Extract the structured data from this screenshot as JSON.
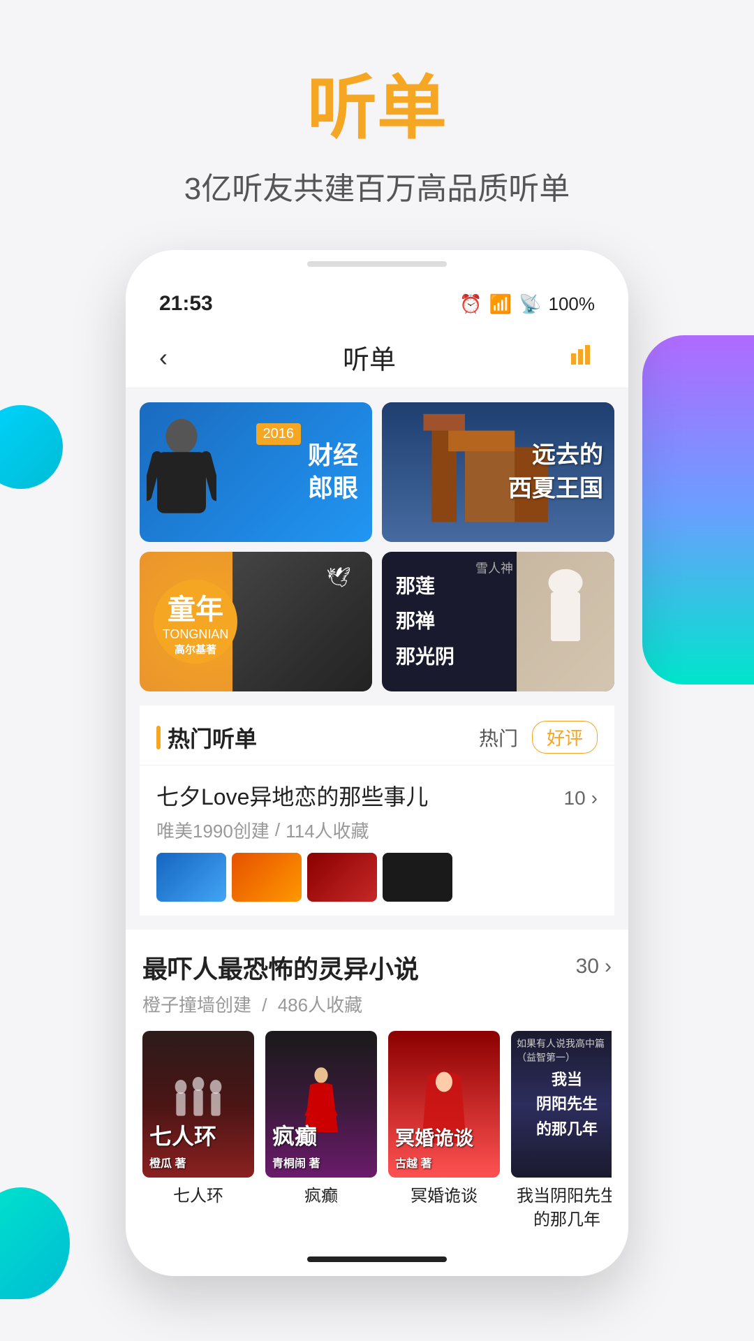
{
  "page": {
    "title": "听单",
    "subtitle": "3亿听友共建百万高品质听单",
    "bg_color": "#f5f5f7",
    "accent_color": "#f5a623"
  },
  "status_bar": {
    "time": "21:53",
    "battery": "100%"
  },
  "nav": {
    "back_icon": "‹",
    "title": "听单",
    "chart_icon": "|||"
  },
  "banners": [
    {
      "id": "b1",
      "year": "2016",
      "title": "财经郎眼",
      "style": "blue"
    },
    {
      "id": "b2",
      "title": "远去的\n西夏王国",
      "style": "desert"
    },
    {
      "id": "b3",
      "main": "童年",
      "sub": "TONGNIAN",
      "author": "高尔基著",
      "style": "childhood"
    },
    {
      "id": "b4",
      "lines": [
        "那莲",
        "那禅",
        "那光阴"
      ],
      "style": "woman"
    }
  ],
  "hot_section": {
    "title": "热门听单",
    "tab_hot": "热门",
    "tab_good": "好评"
  },
  "playlist1": {
    "title": "七夕Love异地恋的那些事儿",
    "creator": "唯美1990创建",
    "saves": "114人收藏",
    "count": "10"
  },
  "playlist2": {
    "title": "最吓人最恐怖的灵异小说",
    "creator": "橙子撞墙创建",
    "saves": "486人收藏",
    "count": "30"
  },
  "books": [
    {
      "id": "bk1",
      "title": "七人环",
      "label": "七人环",
      "style": "book-1"
    },
    {
      "id": "bk2",
      "title": "疯癫",
      "label": "疯癫",
      "style": "book-2"
    },
    {
      "id": "bk3",
      "title": "冥婚诡谈",
      "label": "冥婚诡谈",
      "style": "book-3"
    },
    {
      "id": "bk4",
      "title": "我当阴阳先生的那几年",
      "label": "我当阴阳先生的那几年",
      "style": "book-4"
    }
  ]
}
